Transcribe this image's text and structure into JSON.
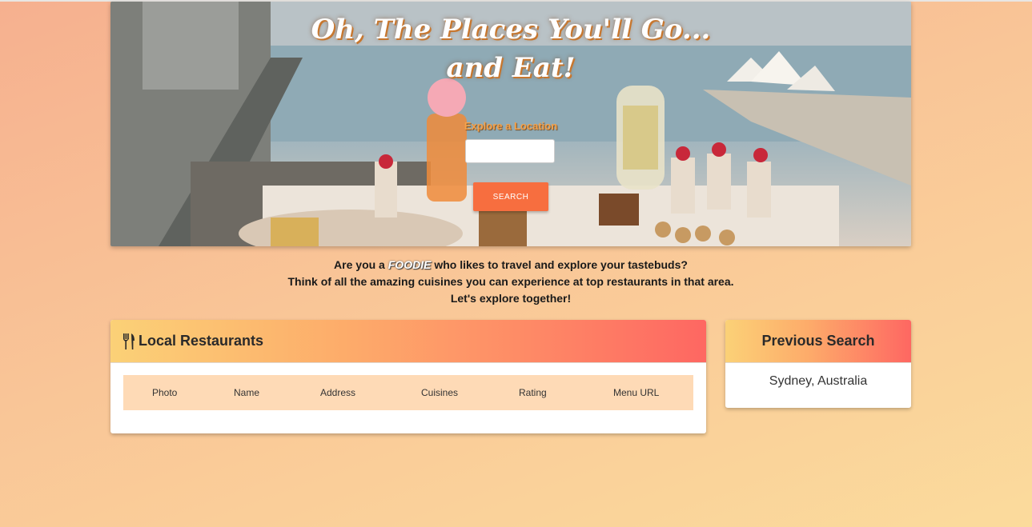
{
  "hero": {
    "title_line1": "Oh, The Places You'll Go...",
    "title_line2": "and Eat!",
    "location_label": "Explore a Location",
    "location_value": "",
    "search_label": "SEARCH"
  },
  "intro": {
    "line1_before": "Are you a",
    "line1_highlight": "FOODIE",
    "line1_after": "who likes to travel and explore your tastebuds?",
    "line2": "Think of all the amazing cuisines you can experience at top restaurants in that area.",
    "line3": "Let's explore together!"
  },
  "local": {
    "title": "Local Restaurants",
    "icon": "fork-knife-icon",
    "columns": [
      "Photo",
      "Name",
      "Address",
      "Cuisines",
      "Rating",
      "Menu URL"
    ]
  },
  "previous": {
    "title": "Previous Search",
    "items": [
      "Sydney, Australia"
    ]
  },
  "colors": {
    "accent": "#f76e3f",
    "header_gradient_start": "#fbd177",
    "header_gradient_end": "#fe6762",
    "table_header_bg": "#fedab6"
  }
}
